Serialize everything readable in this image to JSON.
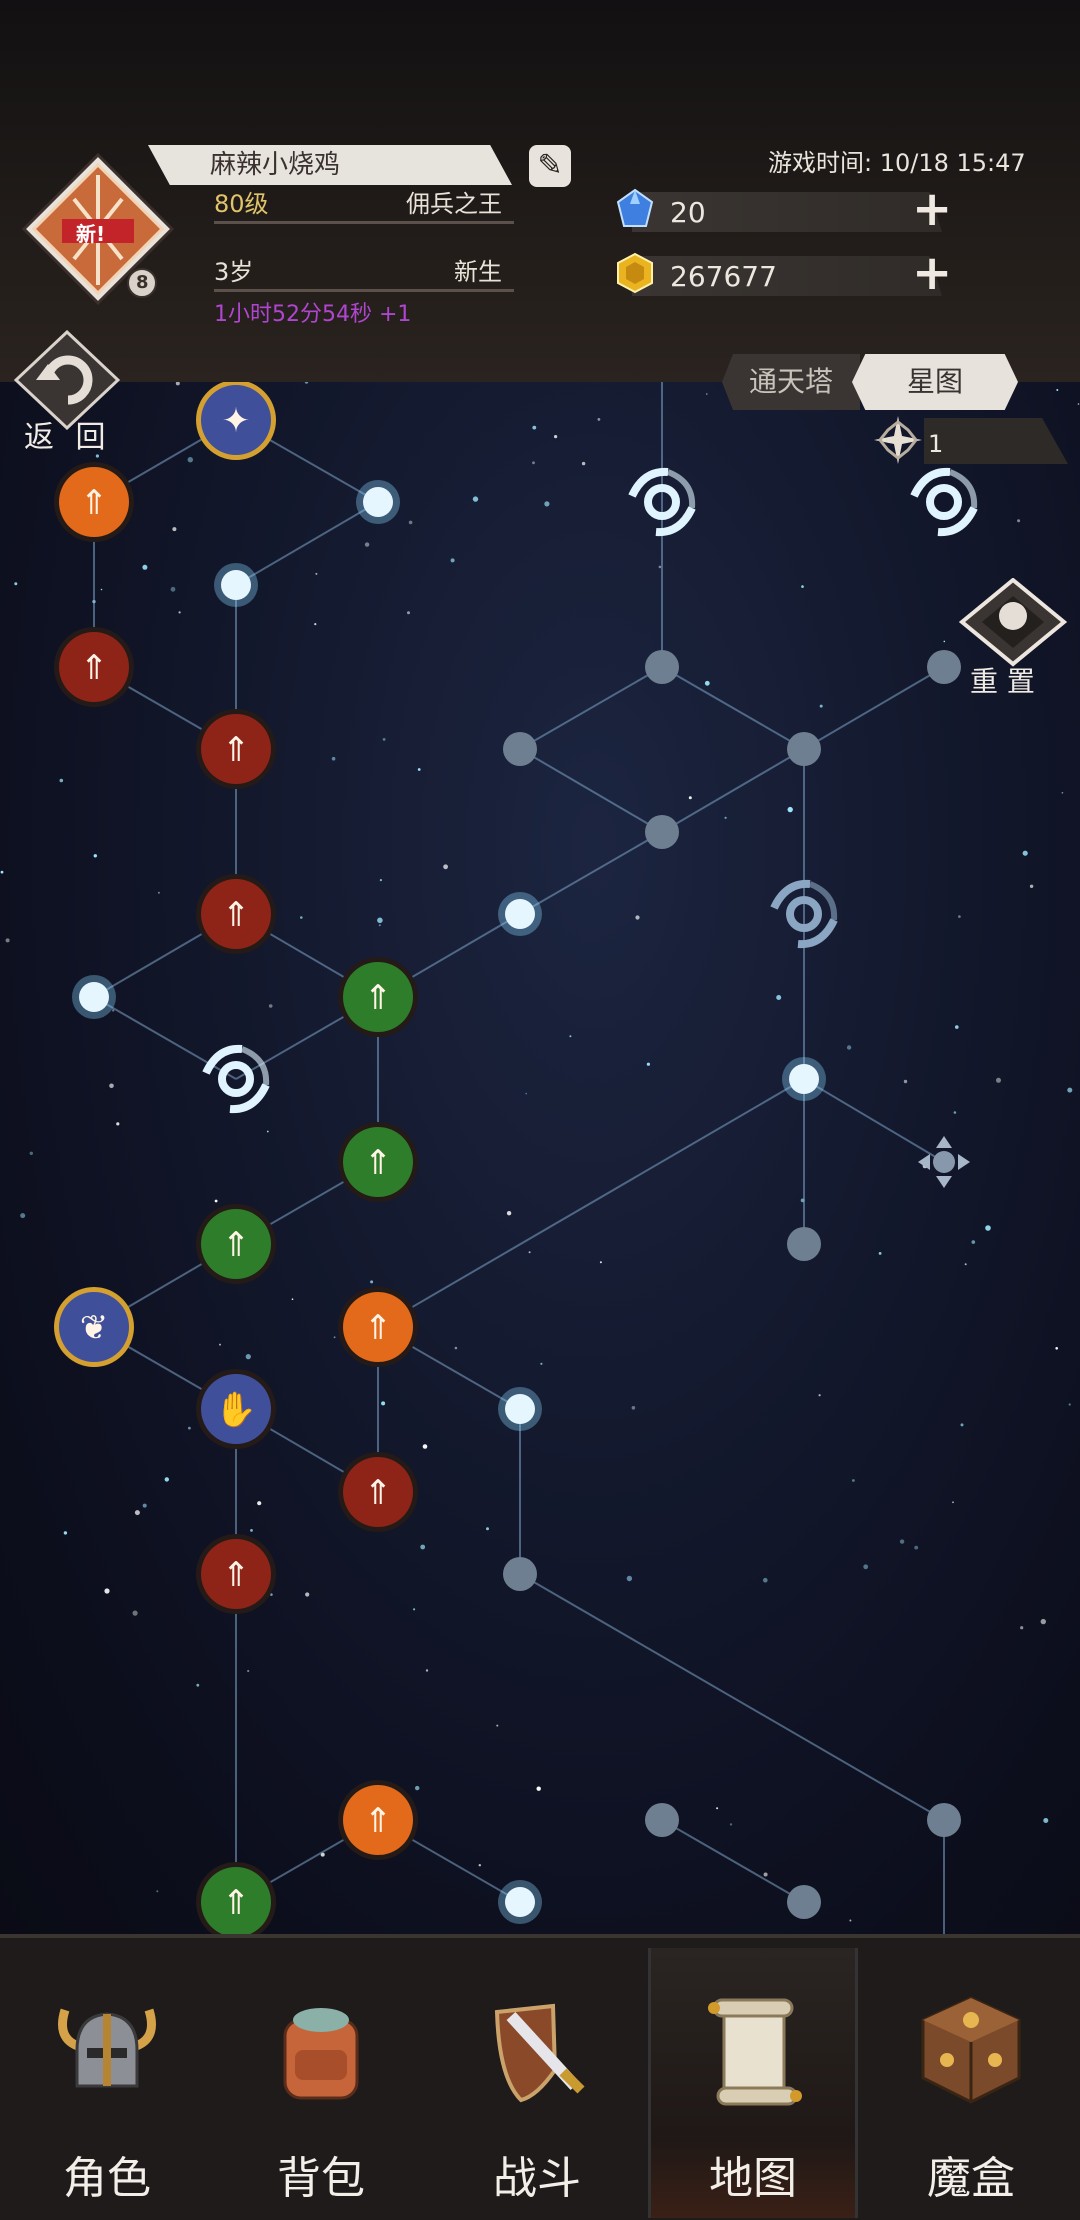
{
  "player": {
    "name": "麻辣小烧鸡",
    "level": "80级",
    "title": "佣兵之王",
    "age": "3岁",
    "stage": "新生",
    "age_timer": "1小时52分54秒 +1",
    "avatar_badge": "新!",
    "avatar_rank": "8"
  },
  "game_time": "游戏时间: 10/18 15:47",
  "resources": {
    "diamonds": "20",
    "gold": "267677"
  },
  "back_label": "返 回",
  "map_tabs": [
    "通天塔",
    "星图"
  ],
  "active_tab": "星图",
  "star_count": "1",
  "reset_label": "重 置",
  "nav": {
    "items": [
      "角色",
      "背包",
      "战斗",
      "地图",
      "魔盒"
    ],
    "active": "地图"
  },
  "colors": {
    "active_node": "#e6f6ff",
    "inactive_node": "#6f7f92",
    "link": "#7da4c8",
    "fire": "#e26a1a",
    "blood": "#8e2318",
    "nature": "#2e7d2a",
    "spirit": "#3f4f9a"
  },
  "icons": [
    "edit-icon",
    "diamond-icon",
    "gold-icon",
    "plus-icon",
    "back-icon",
    "compass-star-icon",
    "reset-icon",
    "vortex-icon",
    "helmet-icon",
    "backpack-icon",
    "sword-shield-icon",
    "scroll-map-icon",
    "magic-box-icon"
  ]
}
